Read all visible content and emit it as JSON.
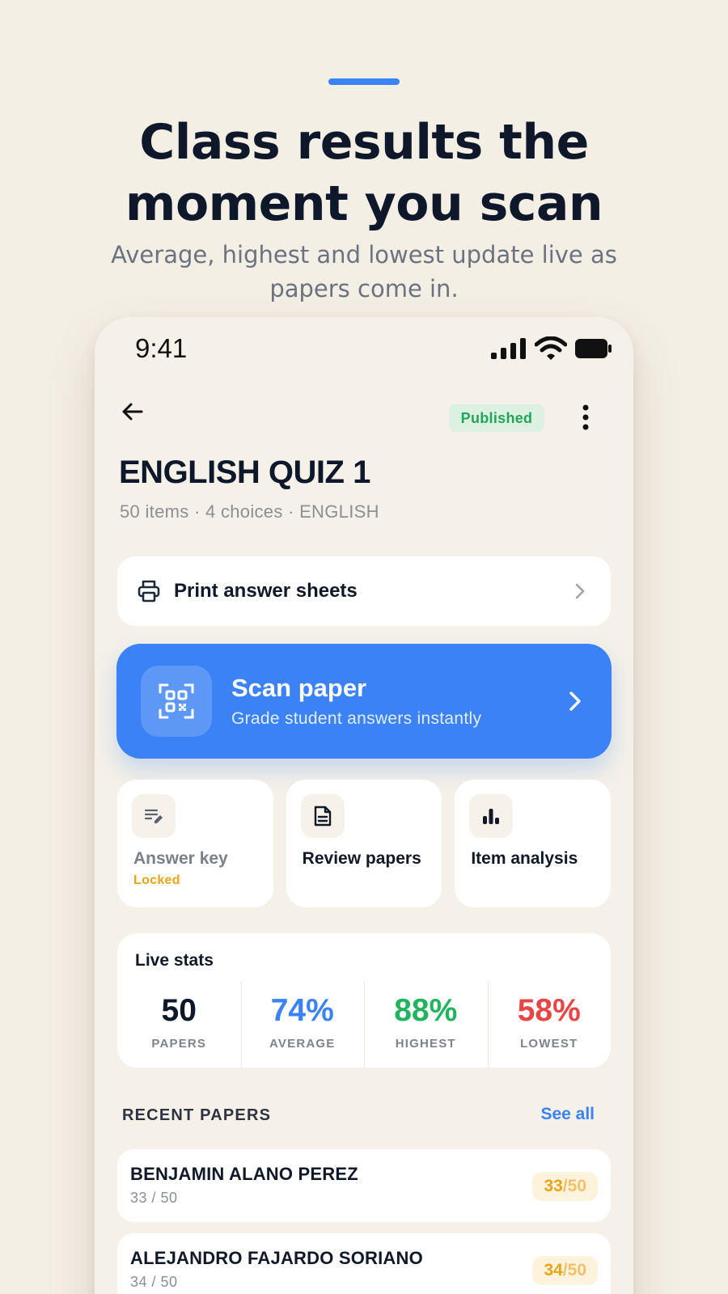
{
  "marketing": {
    "headline_line1": "Class results the",
    "headline_line2": "moment you scan",
    "subhead": "Average, highest and lowest update live as papers come in."
  },
  "status_bar": {
    "time": "9:41"
  },
  "header": {
    "status_badge": "Published"
  },
  "quiz": {
    "title": "ENGLISH QUIZ 1",
    "meta": "50 items · 4 choices · ENGLISH"
  },
  "print": {
    "label": "Print answer sheets"
  },
  "scan": {
    "title": "Scan paper",
    "subtitle": "Grade student answers instantly"
  },
  "tiles": [
    {
      "label": "Answer key",
      "note": "Locked"
    },
    {
      "label": "Review papers"
    },
    {
      "label": "Item analysis"
    }
  ],
  "live_stats": {
    "title": "Live stats",
    "items": [
      {
        "value": "50",
        "label": "PAPERS",
        "color": "#0f172a"
      },
      {
        "value": "74%",
        "label": "AVERAGE",
        "color": "#3b82f6"
      },
      {
        "value": "88%",
        "label": "HIGHEST",
        "color": "#22b35e"
      },
      {
        "value": "58%",
        "label": "LOWEST",
        "color": "#e84545"
      }
    ]
  },
  "recent": {
    "header": "RECENT PAPERS",
    "see_all": "See all",
    "papers": [
      {
        "name": "BENJAMIN ALANO PEREZ",
        "sub": "33 / 50",
        "score": "33",
        "total": "50"
      },
      {
        "name": "ALEJANDRO FAJARDO SORIANO",
        "sub": "34 / 50",
        "score": "34",
        "total": "50"
      }
    ]
  },
  "colors": {
    "accent": "#3b82f6",
    "background": "#f4efe5",
    "published": "#22a55a",
    "locked": "#e8a317"
  }
}
